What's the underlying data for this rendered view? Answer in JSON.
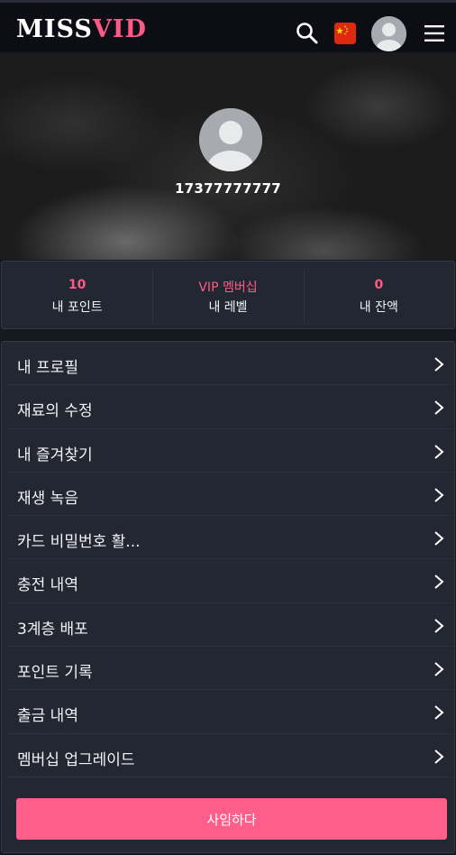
{
  "header": {
    "logo_part1": "MISS",
    "logo_part2": "VID",
    "icons": [
      "search-icon",
      "china-flag-icon",
      "user-avatar-icon",
      "hamburger-menu-icon"
    ]
  },
  "profile": {
    "username": "17377777777"
  },
  "stats": [
    {
      "value": "10",
      "label": "내 포인트"
    },
    {
      "value": "VIP 멤버십",
      "label": "내 레벨"
    },
    {
      "value": "0",
      "label": "내 잔액"
    }
  ],
  "menu": [
    {
      "label": "내 프로필"
    },
    {
      "label": "재료의 수정"
    },
    {
      "label": "내 즐겨찾기"
    },
    {
      "label": "재생 녹음"
    },
    {
      "label": "카드 비밀번호 활..."
    },
    {
      "label": "충전 내역"
    },
    {
      "label": "3계층 배포"
    },
    {
      "label": "포인트 기록"
    },
    {
      "label": "출금 내역"
    },
    {
      "label": "멤버십 업그레이드"
    }
  ],
  "logout_label": "사임하다",
  "colors": {
    "accent": "#ff5a85",
    "button": "#ff5e8b",
    "header_bg": "#0d0d16",
    "panel_bg": "#232731",
    "page_bg": "#15181f"
  }
}
